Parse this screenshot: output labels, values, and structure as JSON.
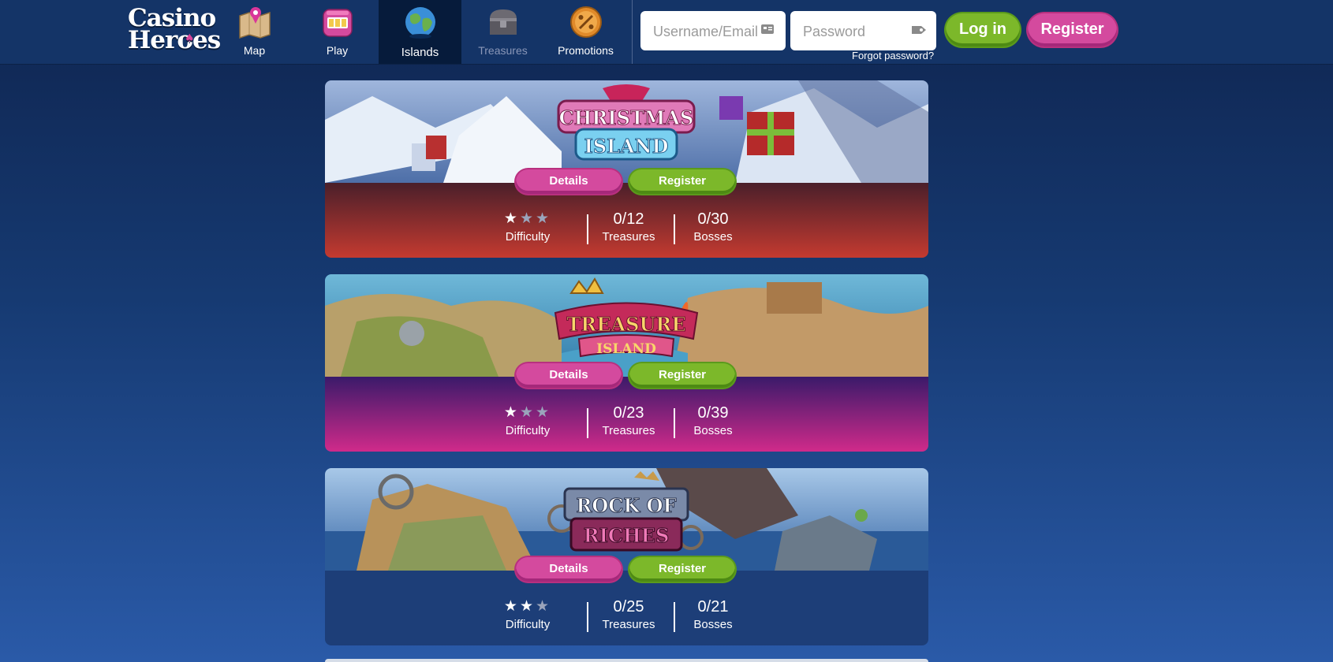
{
  "brand": {
    "line1": "Casino",
    "line2": "Heroes"
  },
  "nav": {
    "items": [
      {
        "label": "Map",
        "icon": "map-icon"
      },
      {
        "label": "Play",
        "icon": "slot-machine-icon"
      },
      {
        "label": "Islands",
        "icon": "globe-icon",
        "active": true
      },
      {
        "label": "Treasures",
        "icon": "treasure-chest-icon",
        "dimmed": true
      },
      {
        "label": "Promotions",
        "icon": "promotion-badge-icon"
      }
    ]
  },
  "login": {
    "username_placeholder": "Username/Email",
    "password_placeholder": "Password",
    "login_label": "Log in",
    "register_label": "Register",
    "forgot_label": "Forgot password?"
  },
  "islands": [
    {
      "name": "Christmas Island",
      "logo_line1": "CHRISTMAS",
      "logo_line2": "ISLAND",
      "details_label": "Details",
      "register_label": "Register",
      "difficulty": 1,
      "difficulty_max": 3,
      "difficulty_label": "Difficulty",
      "treasures": "0/12",
      "treasures_label": "Treasures",
      "bosses": "0/30",
      "bosses_label": "Bosses",
      "stats_color_top": "#4a1f2a",
      "stats_color_bottom": "#c43a30"
    },
    {
      "name": "Treasure Island",
      "logo_line1": "TREASURE",
      "logo_line2": "ISLAND",
      "details_label": "Details",
      "register_label": "Register",
      "difficulty": 1,
      "difficulty_max": 3,
      "difficulty_label": "Difficulty",
      "treasures": "0/23",
      "treasures_label": "Treasures",
      "bosses": "0/39",
      "bosses_label": "Bosses",
      "stats_color_top": "#3a1a6a",
      "stats_color_bottom": "#d02a8a"
    },
    {
      "name": "Rock of Riches",
      "logo_line1": "ROCK OF",
      "logo_line2": "RICHES",
      "details_label": "Details",
      "register_label": "Register",
      "difficulty": 2,
      "difficulty_max": 3,
      "difficulty_label": "Difficulty",
      "treasures": "0/25",
      "treasures_label": "Treasures",
      "bosses": "0/21",
      "bosses_label": "Bosses",
      "stats_color_top": "#1d3e78",
      "stats_color_bottom": "#1d3e78"
    }
  ],
  "colors": {
    "header_bg": "#143467",
    "active_nav_bg": "#061b3b",
    "accent_green": "#7cb82a",
    "accent_pink": "#d44a9e"
  }
}
